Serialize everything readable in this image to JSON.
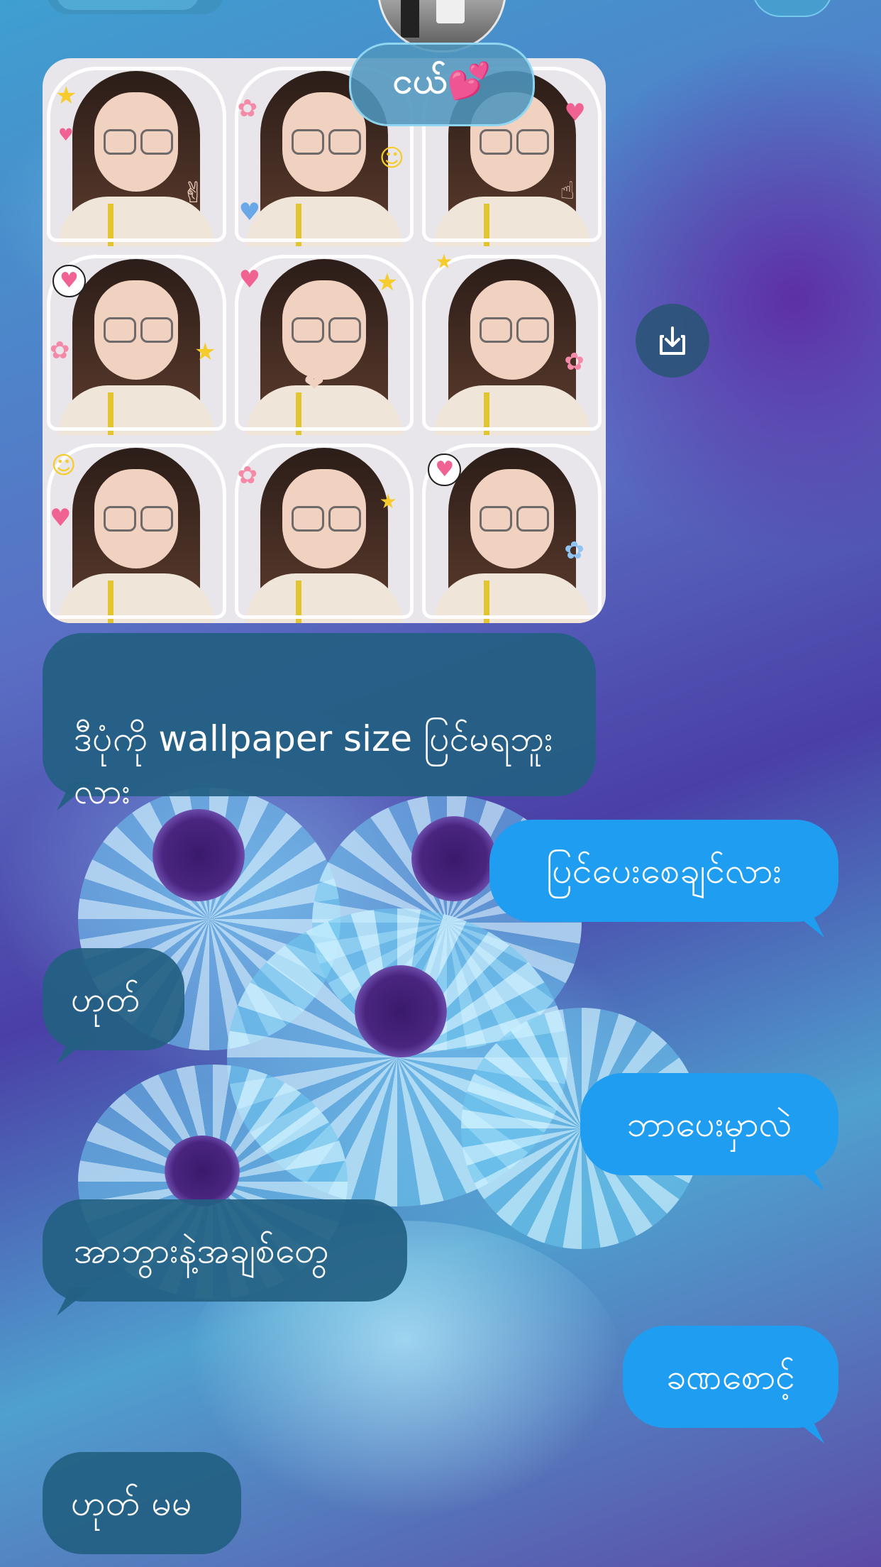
{
  "chat": {
    "contact_name": "ငယ်💕",
    "messages": [
      {
        "side": "received",
        "text": "ဒီပုံကို wallpaper size ပြင်မရဘူး\nလား"
      },
      {
        "side": "sent",
        "text": "ပြင်ပေးစေချင်လား"
      },
      {
        "side": "received",
        "text": "ဟုတ်"
      },
      {
        "side": "sent",
        "text": "ဘာပေးမှာလဲ"
      },
      {
        "side": "received",
        "text": "အာဘွားနဲ့အချစ်တွေ"
      },
      {
        "side": "sent",
        "text": "ခဏစောင့်"
      },
      {
        "side": "received",
        "text": "ဟုတ် မမ"
      }
    ]
  },
  "icons": {
    "download": "download-icon",
    "avatar": "avatar-image"
  },
  "colors": {
    "sent_bubble": "#1f9df0",
    "received_bubble": "#235f82"
  }
}
